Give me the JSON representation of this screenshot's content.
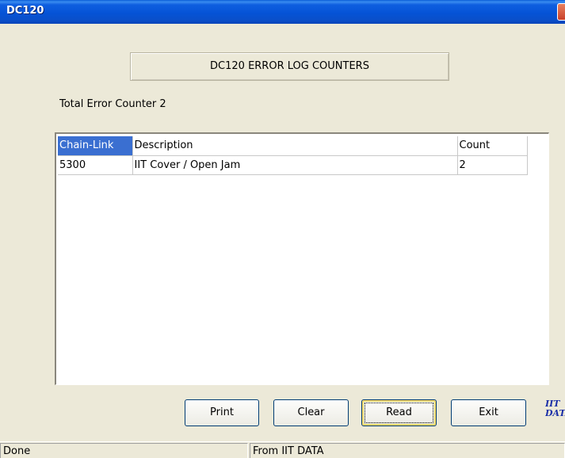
{
  "window": {
    "title": "DC120"
  },
  "header": {
    "label": "DC120 ERROR LOG COUNTERS"
  },
  "total": {
    "label": "Total Error Counter",
    "value": "2"
  },
  "table": {
    "columns": [
      "Chain-Link",
      "Description",
      "Count"
    ],
    "rows": [
      [
        "5300",
        "IIT Cover / Open Jam",
        "2"
      ]
    ]
  },
  "buttons": {
    "print": "Print",
    "clear": "Clear",
    "read": "Read",
    "exit": "Exit"
  },
  "logo": {
    "text": "IIT DATA"
  },
  "status": {
    "left": "Done",
    "right": "From IIT DATA"
  },
  "colors": {
    "titlebar": "#0553d6",
    "selected_header": "#3a6fd1",
    "window_bg": "#ece9d8"
  }
}
